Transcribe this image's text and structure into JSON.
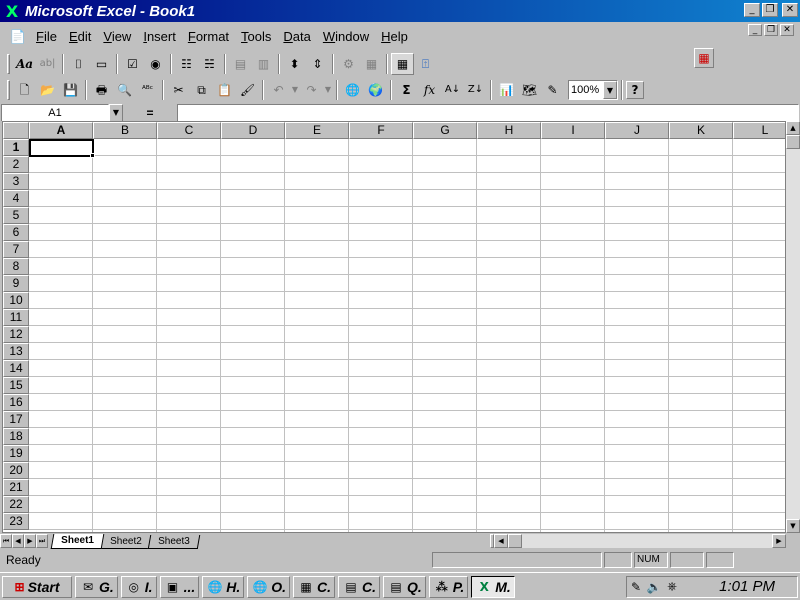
{
  "window": {
    "title": "Microsoft Excel - Book1",
    "minimize_glyph": "_",
    "restore_glyph": "❐",
    "close_glyph": "✕",
    "app_icon_glyph": "X"
  },
  "menu": {
    "items": [
      {
        "hotkey": "F",
        "rest": "ile"
      },
      {
        "hotkey": "E",
        "rest": "dit"
      },
      {
        "hotkey": "V",
        "rest": "iew"
      },
      {
        "hotkey": "I",
        "rest": "nsert"
      },
      {
        "hotkey": "F",
        "rest": "ormat",
        "prefix": ""
      },
      {
        "hotkey": "T",
        "rest": "ools"
      },
      {
        "hotkey": "D",
        "rest": "ata"
      },
      {
        "hotkey": "W",
        "rest": "indow"
      },
      {
        "hotkey": "H",
        "rest": "elp"
      }
    ]
  },
  "forms_toolbar": {
    "label_glyph": "Aa",
    "editbox_glyph": "ab|",
    "group_glyph": "⌷",
    "button_glyph": "▭",
    "checkbox_glyph": "☑",
    "radio_glyph": "◉",
    "list_glyph": "☷",
    "combo_glyph": "☵",
    "combolist_glyph": "▤",
    "dropdown_glyph": "▥",
    "spinner_glyph": "⬍",
    "scroll_glyph": "⇕",
    "properties_glyph": "⚙",
    "code_glyph": "▦",
    "grid_glyph": "▦",
    "run_glyph": "⍐"
  },
  "standard_toolbar": {
    "new_glyph": "🗋",
    "open_glyph": "📂",
    "save_glyph": "💾",
    "print_glyph": "🖶",
    "preview_glyph": "🔍",
    "spelling_glyph": "ᴬᴮᶜ",
    "cut_glyph": "✂",
    "copy_glyph": "⧉",
    "paste_glyph": "📋",
    "format_painter_glyph": "🖌",
    "undo_glyph": "↶",
    "redo_glyph": "↷",
    "web_glyph": "🌐",
    "web2_glyph": "🌍",
    "autosum_glyph": "Σ",
    "function_glyph": "fx",
    "sort_asc_glyph": "A↓",
    "sort_desc_glyph": "Z↓",
    "chart_glyph": "📊",
    "map_glyph": "🗺",
    "drawing_glyph": "✎",
    "zoom": "100%",
    "help_glyph": "?"
  },
  "formula_bar": {
    "name_box": "A1",
    "equals": "=",
    "formula": ""
  },
  "grid": {
    "columns": [
      "A",
      "B",
      "C",
      "D",
      "E",
      "F",
      "G",
      "H",
      "I",
      "J",
      "K",
      "L"
    ],
    "rows": [
      "1",
      "2",
      "3",
      "4",
      "5",
      "6",
      "7",
      "8",
      "9",
      "10",
      "11",
      "12",
      "13",
      "14",
      "15",
      "16",
      "17",
      "18",
      "19",
      "20",
      "21",
      "22",
      "23"
    ],
    "active_cell": "A1"
  },
  "sheets": [
    "Sheet1",
    "Sheet2",
    "Sheet3"
  ],
  "status": {
    "text": "Ready",
    "num_indicator": "NUM"
  },
  "taskbar": {
    "start_label": "Start",
    "buttons": [
      {
        "label": "G.",
        "icon": "✉"
      },
      {
        "label": "I.",
        "icon": "◎"
      },
      {
        "label": "...",
        "icon": "▣"
      },
      {
        "label": "H.",
        "icon": "🌐"
      },
      {
        "label": "O.",
        "icon": "🌐"
      },
      {
        "label": "C.",
        "icon": "▦"
      },
      {
        "label": "C.",
        "icon": "▤"
      },
      {
        "label": "Q.",
        "icon": "▤"
      },
      {
        "label": "P.",
        "icon": "⁂"
      },
      {
        "label": "M.",
        "icon": "X"
      }
    ],
    "clock": "1:01 PM"
  }
}
